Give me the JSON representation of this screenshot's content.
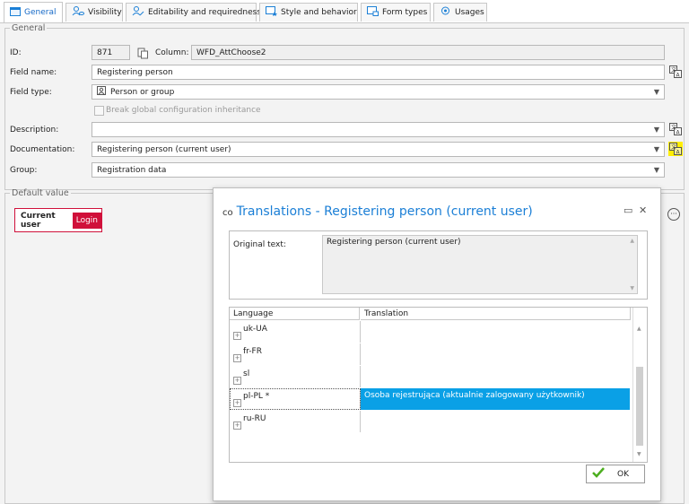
{
  "tabs": [
    {
      "label": "General",
      "icon": "window-icon",
      "active": true
    },
    {
      "label": "Visibility",
      "icon": "user-eye-icon"
    },
    {
      "label": "Editability and requiredness",
      "icon": "user-edit-icon"
    },
    {
      "label": "Style and behavior",
      "icon": "form-star-icon"
    },
    {
      "label": "Form types",
      "icon": "form-types-icon"
    },
    {
      "label": "Usages",
      "icon": "usages-icon"
    }
  ],
  "general": {
    "legend": "General",
    "id_label": "ID:",
    "id_value": "871",
    "column_label": "Column:",
    "column_value": "WFD_AttChoose2",
    "field_name_label": "Field name:",
    "field_name_value": "Registering person",
    "field_type_label": "Field type:",
    "field_type_value": "Person or group",
    "break_inheritance_label": "Break global configuration inheritance",
    "description_label": "Description:",
    "description_value": "",
    "documentation_label": "Documentation:",
    "documentation_value": "Registering person (current user)",
    "group_label": "Group:",
    "group_value": "Registration data"
  },
  "default_value": {
    "legend": "Default value",
    "current_user_label": "Current user",
    "login_label": "Login"
  },
  "dialog": {
    "title_prefix": "co",
    "title": "Translations - Registering person (current user)",
    "original_text_label": "Original text:",
    "original_text_value": "Registering person (current user)",
    "grid_headers": [
      "Language",
      "Translation"
    ],
    "rows": [
      {
        "language": "uk-UA",
        "translation": ""
      },
      {
        "language": "fr-FR",
        "translation": ""
      },
      {
        "language": "sl",
        "translation": ""
      },
      {
        "language": "pl-PL *",
        "translation": "Osoba rejestrująca (aktualnie zalogowany użytkownik)"
      },
      {
        "language": "ru-RU",
        "translation": ""
      }
    ],
    "ok_label": "OK"
  },
  "colors": {
    "accent": "#1b7fd6",
    "selection": "#0aa0e6",
    "login_badge": "#d0103a",
    "highlight_icon": "#ffee00"
  }
}
